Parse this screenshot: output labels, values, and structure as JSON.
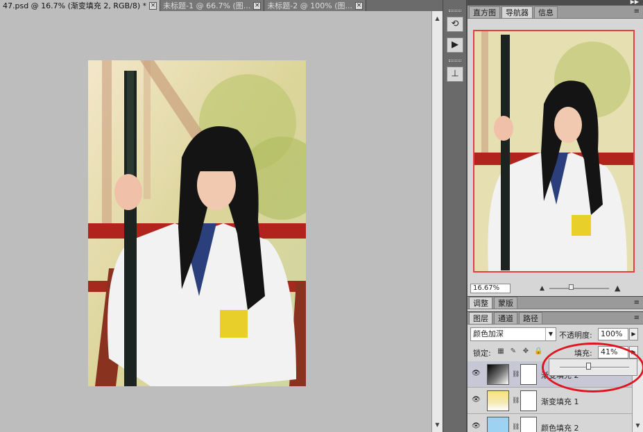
{
  "document_tabs": [
    {
      "label": "47.psd @ 16.7% (渐变填充 2, RGB/8) *",
      "active": true
    },
    {
      "label": "未标题-1 @ 66.7% (图...",
      "active": false
    },
    {
      "label": "未标题-2 @ 100% (图...",
      "active": false
    }
  ],
  "tab_close_glyph": "×",
  "navigator_panel": {
    "tabs": [
      "直方图",
      "导航器",
      "信息"
    ],
    "active_tab": "导航器",
    "zoom_value": "16.67%"
  },
  "adjust_panel": {
    "tabs": [
      "调整",
      "蒙版"
    ]
  },
  "layers_panel": {
    "tabs": [
      "图层",
      "通道",
      "路径"
    ],
    "blend_mode": "颜色加深",
    "opacity_label": "不透明度:",
    "opacity_value": "100%",
    "lock_label": "锁定:",
    "fill_label": "填充:",
    "fill_value": "41%",
    "fill_slider_fraction": 0.41,
    "layers": [
      {
        "name": "渐变填充 2",
        "selected": true,
        "thumb": "black-gradient"
      },
      {
        "name": "渐变填充 1",
        "selected": false,
        "thumb": "yellow-gradient"
      },
      {
        "name": "颜色填充 2",
        "selected": false,
        "thumb": "light-blue-fill"
      }
    ]
  },
  "icons": {
    "collapse": "double-arrow-icon",
    "panel_menu": "panel-menu-icon",
    "eye": "eye-icon"
  },
  "colors": {
    "highlight_ellipse": "#e0141e",
    "navigator_frame": "#e04040"
  }
}
